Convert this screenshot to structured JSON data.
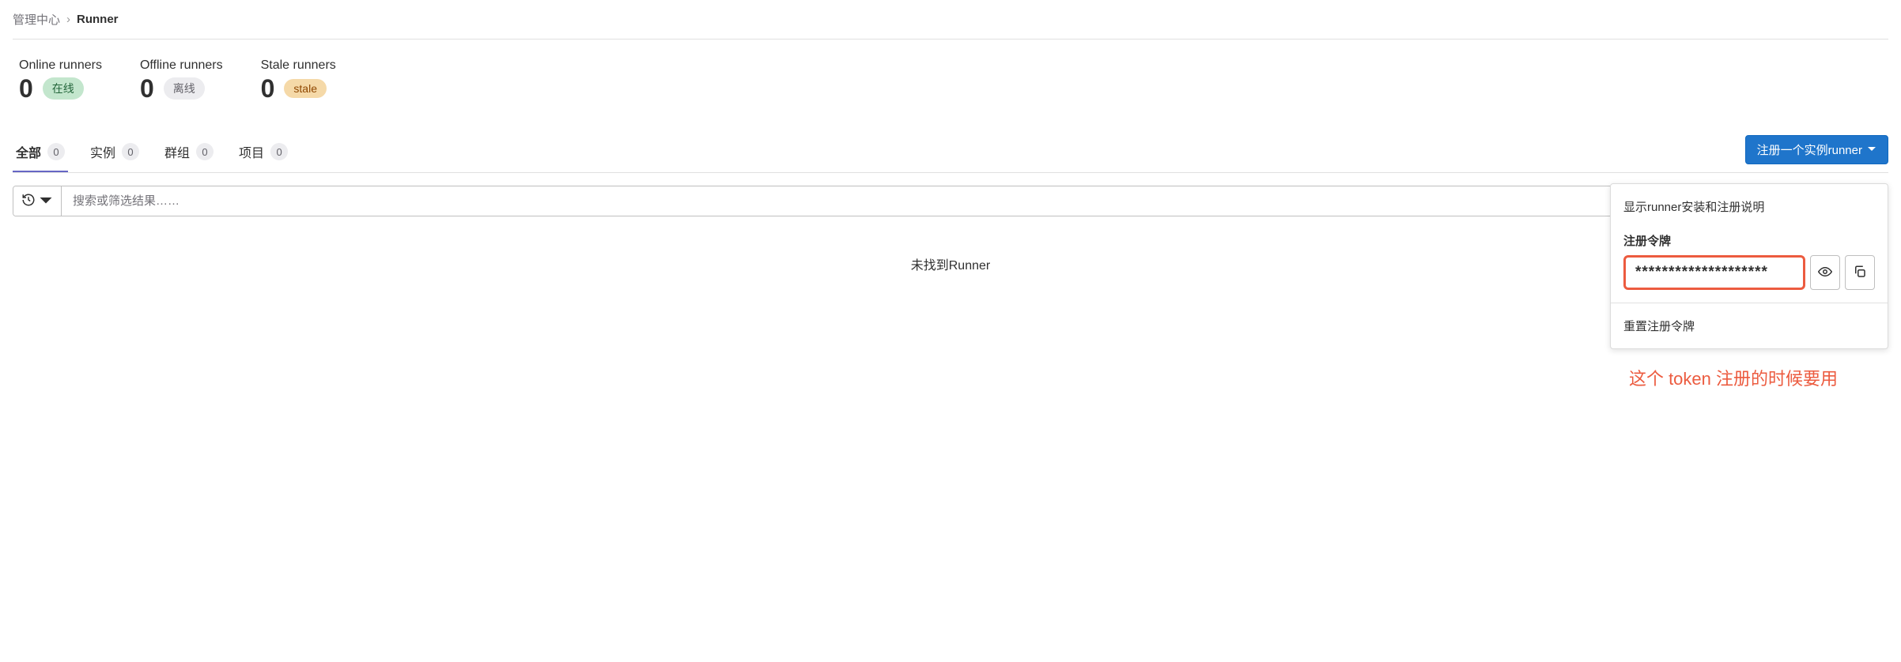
{
  "breadcrumb": {
    "parent": "管理中心",
    "current": "Runner"
  },
  "stats": {
    "online": {
      "label": "Online runners",
      "count": "0",
      "badge": "在线"
    },
    "offline": {
      "label": "Offline runners",
      "count": "0",
      "badge": "离线"
    },
    "stale": {
      "label": "Stale runners",
      "count": "0",
      "badge": "stale"
    }
  },
  "tabs": {
    "all": {
      "label": "全部",
      "count": "0"
    },
    "instance": {
      "label": "实例",
      "count": "0"
    },
    "group": {
      "label": "群组",
      "count": "0"
    },
    "project": {
      "label": "项目",
      "count": "0"
    }
  },
  "register_button": "注册一个实例runner",
  "search": {
    "placeholder": "搜索或筛选结果……"
  },
  "empty": "未找到Runner",
  "dropdown": {
    "install_guide": "显示runner安装和注册说明",
    "token_label": "注册令牌",
    "token_value": "********************",
    "reset_token": "重置注册令牌"
  },
  "annotation": "这个 token 注册的时候要用"
}
